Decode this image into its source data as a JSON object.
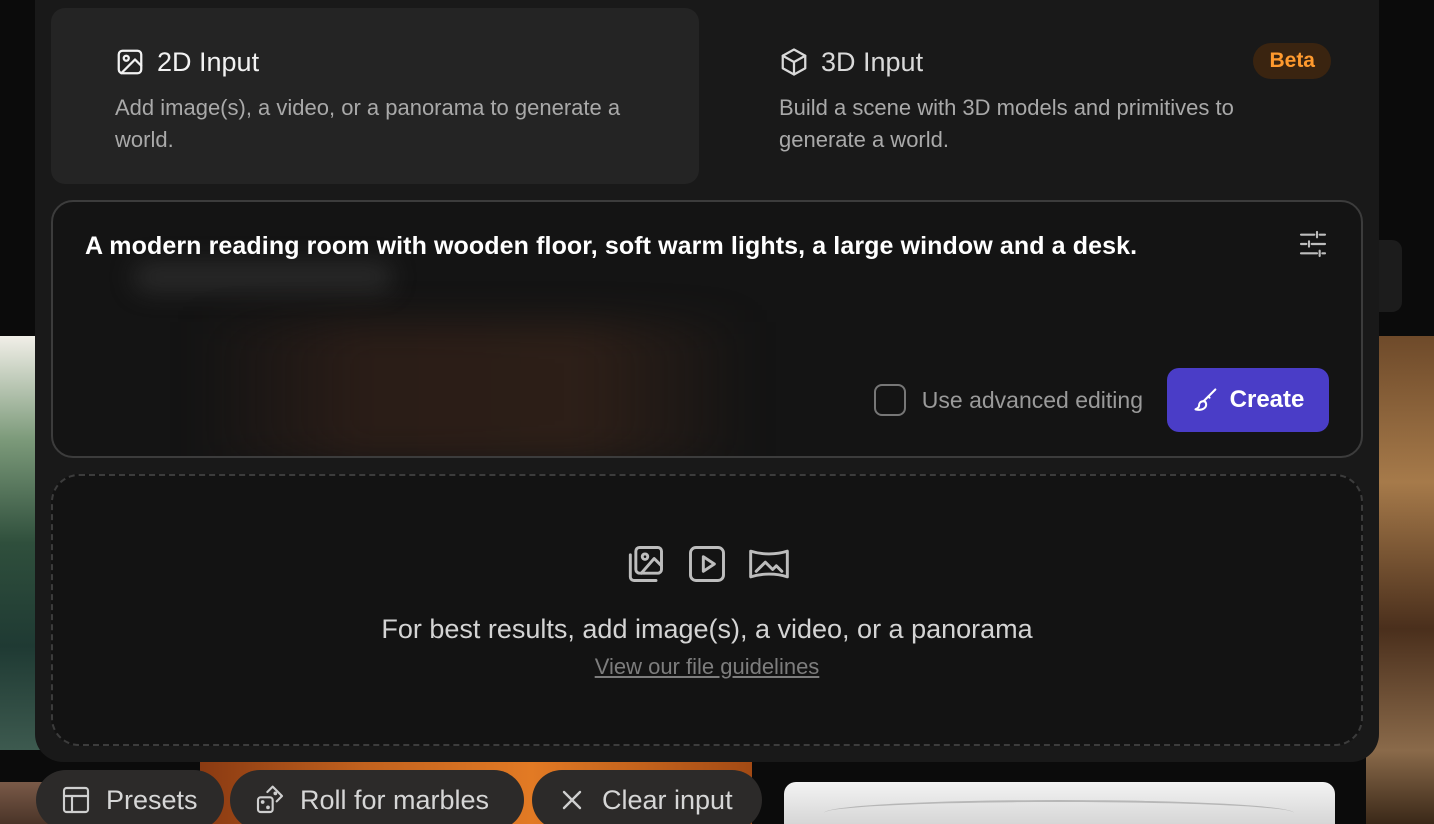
{
  "modes": [
    {
      "title": "2D Input",
      "description": "Add image(s), a video, or a panorama to generate a world.",
      "icon": "image-icon"
    },
    {
      "title": "3D Input",
      "description": "Build a scene with 3D models and primitives to generate a world.",
      "icon": "cube-icon",
      "badge": "Beta"
    }
  ],
  "prompt": {
    "text": "A modern reading room with wooden floor, soft warm lights, a large window and a desk.",
    "advanced_label": "Use advanced editing",
    "create_label": "Create"
  },
  "upload": {
    "icons": [
      "image-upload-icon",
      "video-icon",
      "panorama-icon"
    ],
    "message": "For best results, add image(s), a video, or a panorama",
    "link": "View our file guidelines"
  },
  "bottom_bar": {
    "presets": "Presets",
    "roll": "Roll for marbles",
    "clear": "Clear input"
  },
  "colors": {
    "accent": "#4a3dc7",
    "beta": "#ff9a2e",
    "panel": "#191919"
  }
}
